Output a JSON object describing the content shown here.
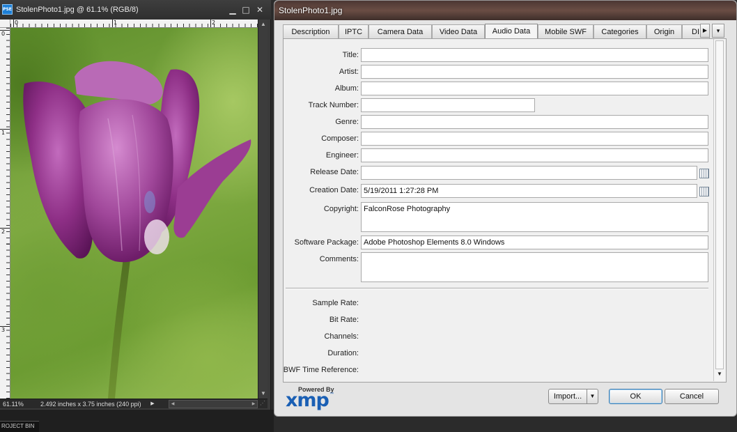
{
  "document": {
    "app_badge": "PSE",
    "title": "StolenPhoto1.jpg @ 61.1% (RGB/8)",
    "ruler_h_labels": [
      "0",
      "1",
      "2"
    ],
    "ruler_v_labels": [
      "0",
      "1",
      "2",
      "3"
    ],
    "zoom": "61.11%",
    "doc_size": "2.492 inches x 3.75 inches (240 ppi)",
    "project_bin_label": "ROJECT BIN"
  },
  "dialog": {
    "title": "StolenPhoto1.jpg",
    "tabs": [
      {
        "label": "Description"
      },
      {
        "label": "IPTC"
      },
      {
        "label": "Camera Data"
      },
      {
        "label": "Video Data"
      },
      {
        "label": "Audio Data",
        "active": true
      },
      {
        "label": "Mobile SWF"
      },
      {
        "label": "Categories"
      },
      {
        "label": "Origin"
      },
      {
        "label": "DI"
      }
    ],
    "fields": {
      "title": {
        "label": "Title:",
        "value": ""
      },
      "artist": {
        "label": "Artist:",
        "value": ""
      },
      "album": {
        "label": "Album:",
        "value": ""
      },
      "track_number": {
        "label": "Track Number:",
        "value": ""
      },
      "genre": {
        "label": "Genre:",
        "value": ""
      },
      "composer": {
        "label": "Composer:",
        "value": ""
      },
      "engineer": {
        "label": "Engineer:",
        "value": ""
      },
      "release_date": {
        "label": "Release Date:",
        "value": ""
      },
      "creation_date": {
        "label": "Creation Date:",
        "value": "5/19/2011 1:27:28 PM"
      },
      "copyright": {
        "label": "Copyright:",
        "value": "FalconRose Photography"
      },
      "software_package": {
        "label": "Software Package:",
        "value": "Adobe Photoshop Elements 8.0 Windows"
      },
      "comments": {
        "label": "Comments:",
        "value": ""
      }
    },
    "readonly": {
      "sample_rate": "Sample Rate:",
      "bit_rate": "Bit Rate:",
      "channels": "Channels:",
      "duration": "Duration:",
      "bwf_time_reference": "BWF Time Reference:"
    },
    "footer": {
      "powered_by": "Powered By",
      "xmp_logo": "xmp",
      "xmp_tm": "™",
      "import_label": "Import...",
      "ok_label": "OK",
      "cancel_label": "Cancel"
    }
  }
}
